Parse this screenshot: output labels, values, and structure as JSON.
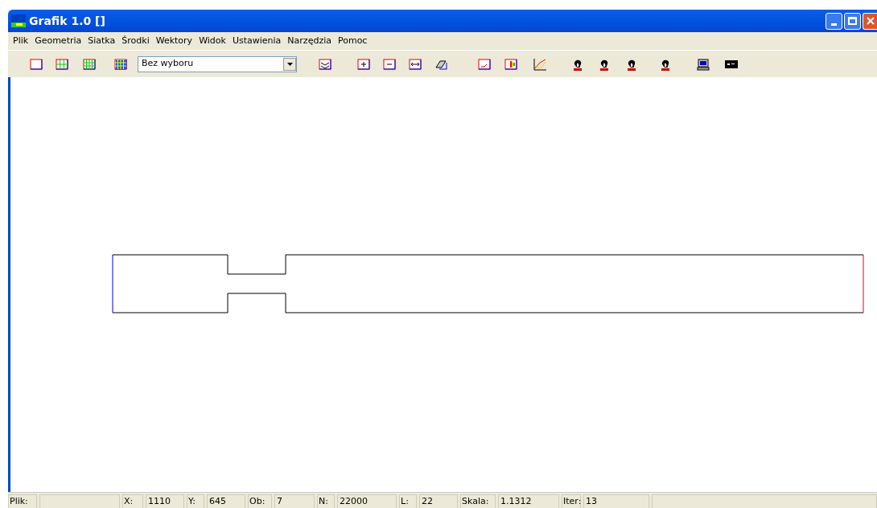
{
  "window": {
    "title": "Grafik 1.0 []"
  },
  "menu": [
    "Plik",
    "Geometria",
    "Siatka",
    "Środki",
    "Wektory",
    "Widok",
    "Ustawienia",
    "Narzędzia",
    "Pomoc"
  ],
  "toolbar": {
    "selection": "Bez wyboru"
  },
  "status_bar": [
    {
      "label": "Plik:"
    },
    {
      "label": "X:",
      "value": "1110"
    },
    {
      "label": "Y:",
      "value": "645"
    },
    {
      "label": "Ob:",
      "value": "7"
    },
    {
      "label": "N:",
      "value": "22000"
    },
    {
      "label": "L:",
      "value": "22"
    },
    {
      "label": "Skala:",
      "value": "1.1312"
    },
    {
      "label": "Iter:",
      "value": "13"
    }
  ]
}
